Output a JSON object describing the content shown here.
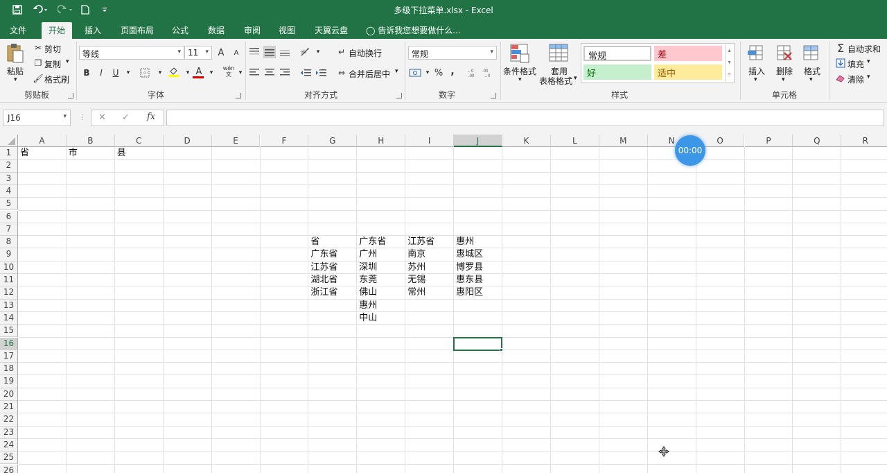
{
  "window": {
    "title": "多级下拉菜单.xlsx - Excel"
  },
  "tabs": [
    "文件",
    "开始",
    "插入",
    "页面布局",
    "公式",
    "数据",
    "审阅",
    "视图",
    "天翼云盘"
  ],
  "tell_me": "告诉我您想要做什么...",
  "clipboard": {
    "paste": "粘贴",
    "cut": "剪切",
    "copy": "复制",
    "format_painter": "格式刷",
    "label": "剪贴板"
  },
  "font": {
    "name": "等线",
    "size": "11",
    "label": "字体",
    "bold": "B",
    "italic": "I",
    "underline": "U",
    "grow": "A",
    "shrink": "A",
    "font_color": "A",
    "phonetic": "wén 文"
  },
  "alignment": {
    "wrap": "自动换行",
    "merge": "合并后居中",
    "label": "对齐方式"
  },
  "number": {
    "format": "常规",
    "percent": "%",
    "comma": ",",
    "label": "数字"
  },
  "styles": {
    "cond": "条件格式",
    "table_line1": "套用",
    "table_line2": "表格格式",
    "normal": "常规",
    "bad": "差",
    "good": "好",
    "neutral": "适中",
    "label": "样式"
  },
  "cells": {
    "insert": "插入",
    "delete": "删除",
    "format": "格式",
    "label": "单元格"
  },
  "editing": {
    "autosum": "自动求和",
    "fill": "填充",
    "clear": "清除"
  },
  "colors": {
    "accent": "#217346",
    "bad_bg": "#ffc7ce",
    "bad_fg": "#9c0006",
    "good_bg": "#c6efce",
    "good_fg": "#006100",
    "neutral_bg": "#ffeb9c",
    "neutral_fg": "#9c5700"
  },
  "formula_bar": {
    "name_box": "J16",
    "cancel": "✕",
    "enter": "✓",
    "fx": "fx",
    "formula": ""
  },
  "grid": {
    "columns": [
      "A",
      "B",
      "C",
      "D",
      "E",
      "F",
      "G",
      "H",
      "I",
      "J",
      "K",
      "L",
      "M",
      "N",
      "O",
      "P",
      "Q",
      "R"
    ],
    "rows": [
      "1",
      "2",
      "3",
      "4",
      "5",
      "6",
      "7",
      "8",
      "9",
      "10",
      "11",
      "12",
      "13",
      "14",
      "15",
      "16",
      "17",
      "18",
      "19",
      "20",
      "21",
      "22",
      "23",
      "24",
      "25",
      "26"
    ],
    "selected_cell": "J16",
    "cells": {
      "A1": "省",
      "B1": "市",
      "C1": "县",
      "G8": "省",
      "G9": "广东省",
      "G10": "江苏省",
      "G11": "湖北省",
      "G12": "浙江省",
      "H8": "广东省",
      "H9": "广州",
      "H10": "深圳",
      "H11": "东莞",
      "H12": "佛山",
      "H13": "惠州",
      "H14": "中山",
      "I8": "江苏省",
      "I9": "南京",
      "I10": "苏州",
      "I11": "无锡",
      "I12": "常州",
      "J8": "惠州",
      "J9": "惠城区",
      "J10": "博罗县",
      "J11": "惠东县",
      "J12": "惠阳区"
    }
  },
  "timer": "00:00"
}
